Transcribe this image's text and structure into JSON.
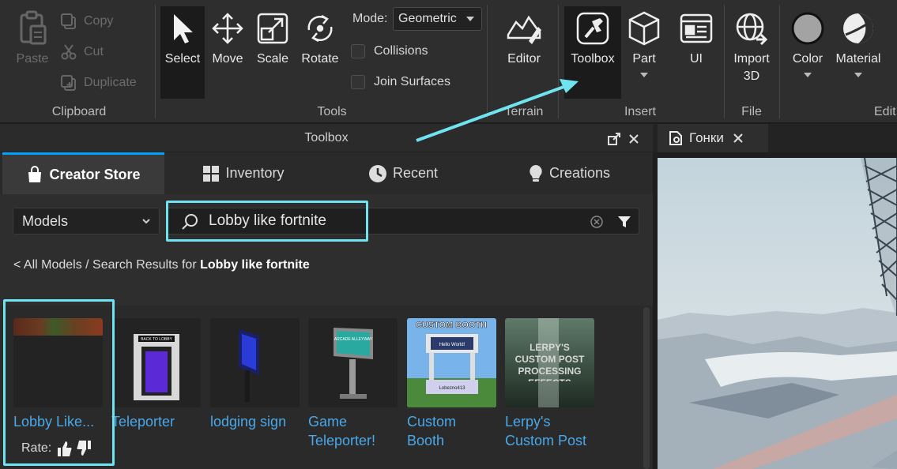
{
  "ribbon": {
    "clipboard": {
      "paste": "Paste",
      "copy": "Copy",
      "cut": "Cut",
      "duplicate": "Duplicate",
      "group": "Clipboard"
    },
    "tools": {
      "select": "Select",
      "move": "Move",
      "scale": "Scale",
      "rotate": "Rotate",
      "mode_label": "Mode:",
      "mode_value": "Geometric",
      "collisions": "Collisions",
      "join_surfaces": "Join Surfaces",
      "group": "Tools"
    },
    "terrain": {
      "editor": "Editor",
      "group": "Terrain"
    },
    "insert": {
      "toolbox": "Toolbox",
      "part": "Part",
      "ui": "UI",
      "group": "Insert"
    },
    "file": {
      "import_3d_line1": "Import",
      "import_3d_line2": "3D",
      "group": "File"
    },
    "edit": {
      "color": "Color",
      "material": "Material",
      "group": "Edit"
    }
  },
  "toolbox": {
    "title": "Toolbox",
    "tabs": [
      {
        "label": "Creator Store",
        "icon": "shopping-bag-icon",
        "active": true
      },
      {
        "label": "Inventory",
        "icon": "grid-icon",
        "active": false
      },
      {
        "label": "Recent",
        "icon": "clock-icon",
        "active": false
      },
      {
        "label": "Creations",
        "icon": "lightbulb-icon",
        "active": false
      }
    ],
    "category": "Models",
    "search_query": "Lobby like fortnite",
    "breadcrumb": {
      "prefix": "< All Models / Search Results for ",
      "query": "Lobby like fortnite"
    },
    "results": [
      {
        "name": "Lobby Like...",
        "name_line2": ""
      },
      {
        "name": "Teleporter",
        "name_line2": ""
      },
      {
        "name": "lodging sign",
        "name_line2": ""
      },
      {
        "name": "Game",
        "name_line2": "Teleporter!"
      },
      {
        "name": "Custom",
        "name_line2": "Booth"
      },
      {
        "name": "Lerpy's",
        "name_line2": "Custom Post"
      }
    ],
    "rate_label": "Rate:",
    "thumb_text": {
      "back_to_lobby": "BACK TO LOBBY",
      "custom_booth": "CUSTOM BOOTH",
      "hello_world": "Hello World!",
      "booth_author": "Lobezno413",
      "lerpy_title": "LERPY'S CUSTOM POST PROCESSING EFFECTS",
      "sign_text": "ARCADE ALLEYWAY"
    }
  },
  "viewport": {
    "tab_label": "Гонки"
  },
  "colors": {
    "highlight": "#6fe3ef",
    "accent": "#00a2ff",
    "link": "#4aa8e8"
  }
}
